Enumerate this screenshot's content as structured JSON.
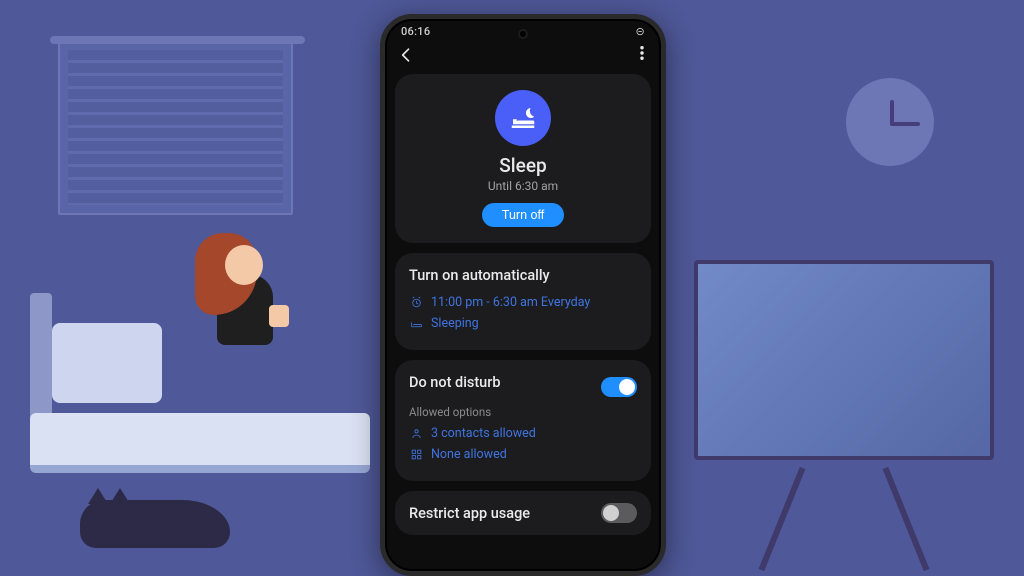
{
  "status": {
    "time": "06:16",
    "indicator": "⊝"
  },
  "header": {
    "mode_name": "Sleep",
    "subtitle": "Until 6:30 am",
    "toggle_button": "Turn off"
  },
  "auto": {
    "title": "Turn on automatically",
    "schedule": "11:00 pm - 6:30 am Everyday",
    "condition": "Sleeping"
  },
  "dnd": {
    "title": "Do not disturb",
    "enabled": true,
    "allowed_label": "Allowed options",
    "contacts": "3 contacts allowed",
    "apps": "None allowed"
  },
  "restrict": {
    "title": "Restrict app usage",
    "enabled": false
  }
}
